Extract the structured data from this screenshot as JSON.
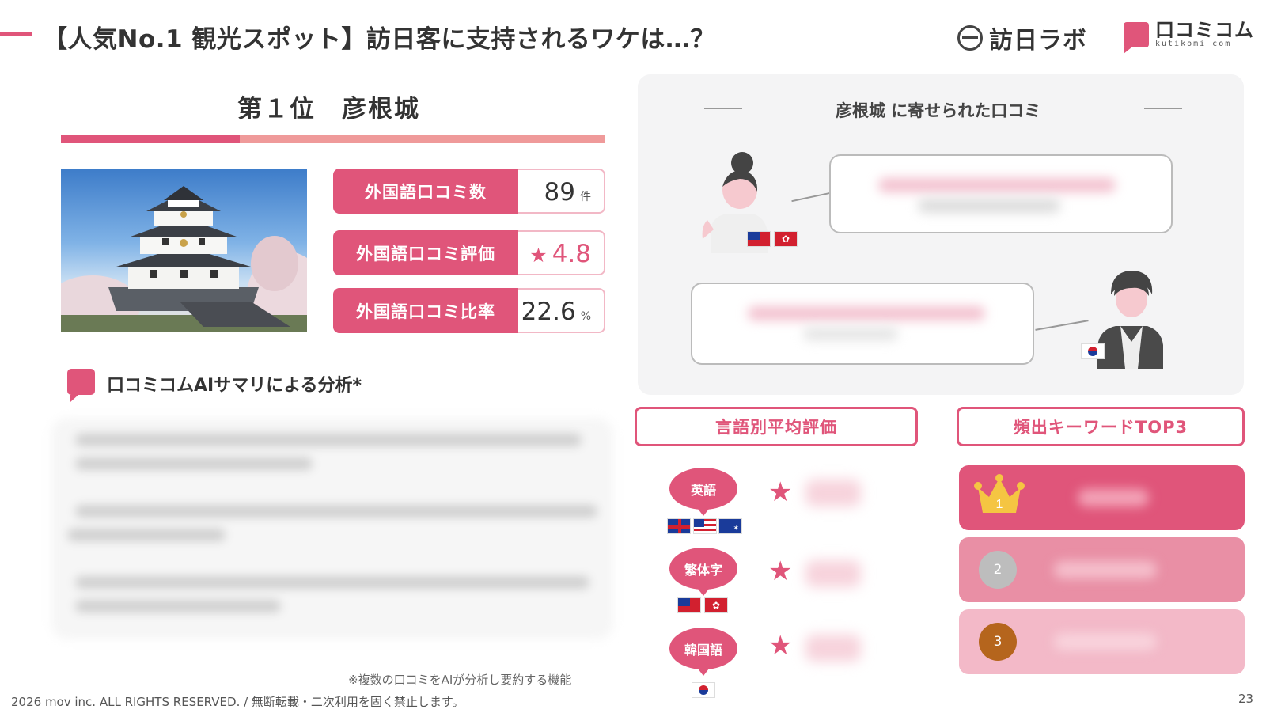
{
  "header": {
    "title": "【人気No.1 観光スポット】訪日客に支持されるワケは…？",
    "logo_labo": "訪日ラボ",
    "logo_kutikomi": "口コミコム",
    "logo_kutikomi_sub": "kutikomi com"
  },
  "rank": {
    "title": "第１位　彦根城"
  },
  "stats": [
    {
      "label": "外国語口コミ数",
      "value": "89",
      "unit": "件"
    },
    {
      "label": "外国語口コミ評価",
      "star": "★",
      "value": "4.8"
    },
    {
      "label": "外国語口コミ比率",
      "value": "22.6",
      "unit": "%"
    }
  ],
  "ai_summary": {
    "title": "口コミコムAIサマリによる分析*"
  },
  "reviews": {
    "title": "彦根城 に寄せられた口コミ",
    "flags": {
      "hk_symbol": "✿",
      "au_symbol": "✶"
    }
  },
  "language_rating": {
    "title": "言語別平均評価",
    "star": "★",
    "languages": [
      {
        "name": "英語"
      },
      {
        "name": "繁体字"
      },
      {
        "name": "韓国語"
      }
    ]
  },
  "keywords": {
    "title": "頻出キーワードTOP3",
    "ranks": [
      "1",
      "2",
      "3"
    ],
    "colors": [
      "#e0557a",
      "#e98fa5",
      "#f3b9c8"
    ]
  },
  "footer": {
    "note": "※複数の口コミをAIが分析し要約する機能",
    "copyright": "2026 mov inc. ALL RIGHTS RESERVED. / 無断転載・二次利用を固く禁止します。",
    "page_number": "23"
  }
}
